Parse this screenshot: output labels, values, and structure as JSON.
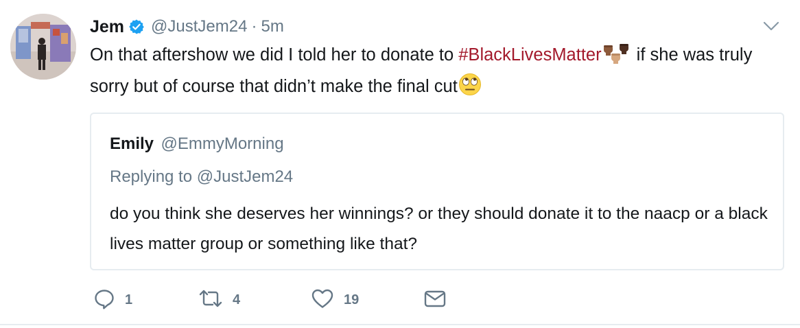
{
  "tweet": {
    "author_name": "Jem",
    "author_handle": "@JustJem24",
    "separator": "·",
    "timestamp": "5m",
    "avatar_icon": "profile-photo",
    "text_before": "On that aftershow we did I told her to donate to ",
    "hashtag": "#BlackLivesMatter",
    "text_after": " if she was truly sorry but of course that didn’t make the final cut",
    "emoji_1": "raised-fists-emoji",
    "emoji_2": "eye-roll-emoji",
    "hashtag_color": "#a3192b",
    "verified_color": "#1da1f2"
  },
  "quote": {
    "author_name": "Emily",
    "author_handle": "@EmmyMorning",
    "replying_to": "Replying to @JustJem24",
    "text": "do you think she deserves her winnings? or they should donate it to the naacp or a black lives matter group or something like that?"
  },
  "actions": {
    "reply_count": "1",
    "retweet_count": "4",
    "like_count": "19",
    "icons": [
      "reply-icon",
      "retweet-icon",
      "like-icon",
      "message-icon"
    ]
  }
}
